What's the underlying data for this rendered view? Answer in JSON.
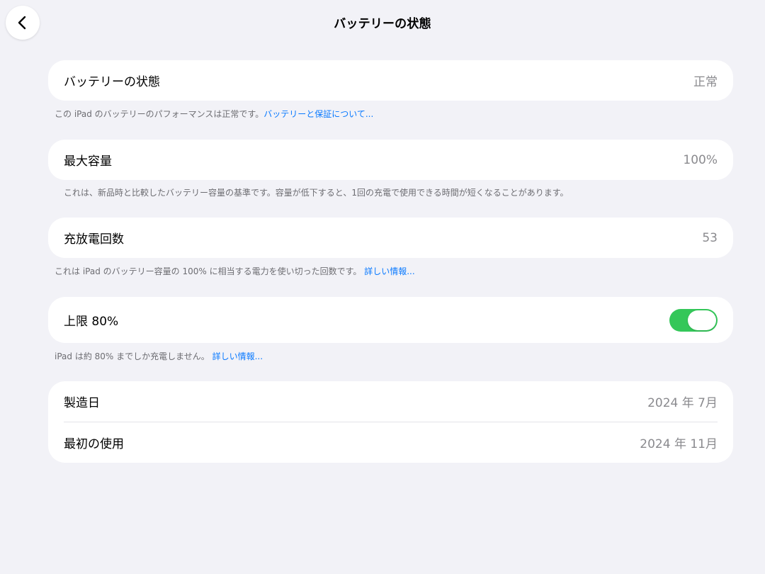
{
  "nav": {
    "title": "バッテリーの状態",
    "back_icon": "chevron-left-icon"
  },
  "battery_health": {
    "label": "バッテリーの状態",
    "value": "正常",
    "footnote_text": "この iPad のバッテリーのパフォーマンスは正常です。",
    "footnote_link": "バッテリーと保証について..."
  },
  "max_capacity": {
    "label": "最大容量",
    "value": "100%",
    "footnote_text": "これは、新品時と比較したバッテリー容量の基準です。容量が低下すると、1回の充電で使用できる時間が短くなることがあります。"
  },
  "cycle_count": {
    "label": "充放電回数",
    "value": "53",
    "footnote_text": "これは iPad のバッテリー容量の 100% に相当する電力を使い切った回数です。",
    "footnote_link": "詳しい情報..."
  },
  "limit_80": {
    "label": "上限 80%",
    "toggle_on": true,
    "toggle_color": "#34c759",
    "footnote_text": "iPad は約 80% までしか充電しません。",
    "footnote_link": "詳しい情報..."
  },
  "dates": {
    "manufacture_label": "製造日",
    "manufacture_value": "2024 年 7月",
    "first_use_label": "最初の使用",
    "first_use_value": "2024 年 11月"
  }
}
